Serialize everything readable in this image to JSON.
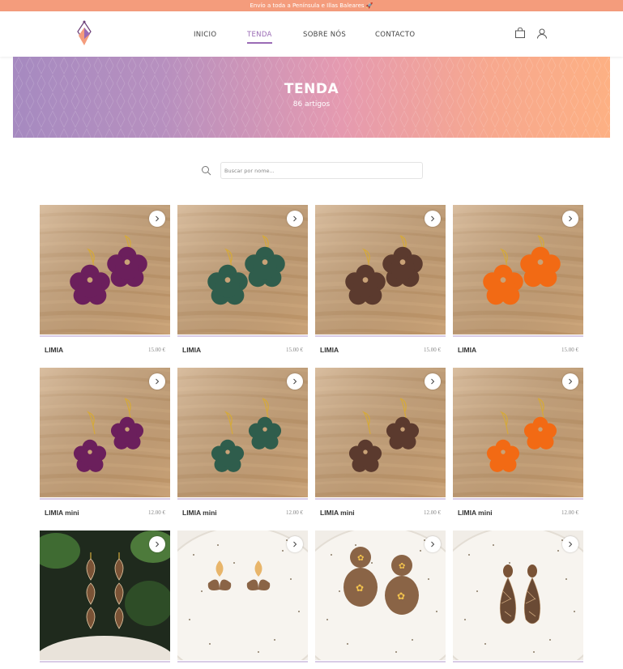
{
  "announcement": "Envío a toda a Península e Illas Baleares 🚀",
  "nav": {
    "items": [
      {
        "label": "INICIO",
        "active": false
      },
      {
        "label": "TENDA",
        "active": true
      },
      {
        "label": "SOBRE NÓS",
        "active": false
      },
      {
        "label": "CONTACTO",
        "active": false
      }
    ],
    "icons": [
      "shopping-bag-icon",
      "user-icon"
    ]
  },
  "banner": {
    "title": "TENDA",
    "subtitle": "86 artigos"
  },
  "search": {
    "placeholder": "Buscar por nome...",
    "value": ""
  },
  "colors": {
    "accent": "#9a6bb5",
    "topbar": "#f49c7c",
    "card_bar": "#d9cce6"
  },
  "products": [
    {
      "name": "LIMIA",
      "price": "15.00 €",
      "color": "#6b1f5c",
      "bg": "wood"
    },
    {
      "name": "LIMIA",
      "price": "15.00 €",
      "color": "#2f5d4c",
      "bg": "wood"
    },
    {
      "name": "LIMIA",
      "price": "15.00 €",
      "color": "#5b3a2e",
      "bg": "wood"
    },
    {
      "name": "LIMIA",
      "price": "15.00 €",
      "color": "#f26a14",
      "bg": "wood"
    },
    {
      "name": "LIMIA mini",
      "price": "12.00 €",
      "color": "#6b1f5c",
      "bg": "wood"
    },
    {
      "name": "LIMIA mini",
      "price": "12.00 €",
      "color": "#2f5d4c",
      "bg": "wood"
    },
    {
      "name": "LIMIA mini",
      "price": "12.00 €",
      "color": "#5b3a2e",
      "bg": "wood"
    },
    {
      "name": "LIMIA mini",
      "price": "12.00 €",
      "color": "#f26a14",
      "bg": "wood"
    },
    {
      "name": "",
      "price": "",
      "color": "#7a5336",
      "bg": "plant"
    },
    {
      "name": "",
      "price": "",
      "color": "#e8b56a",
      "bg": "plate"
    },
    {
      "name": "",
      "price": "",
      "color": "#8a6446",
      "bg": "plate"
    },
    {
      "name": "",
      "price": "",
      "color": "#6a4a34",
      "bg": "plate"
    }
  ]
}
